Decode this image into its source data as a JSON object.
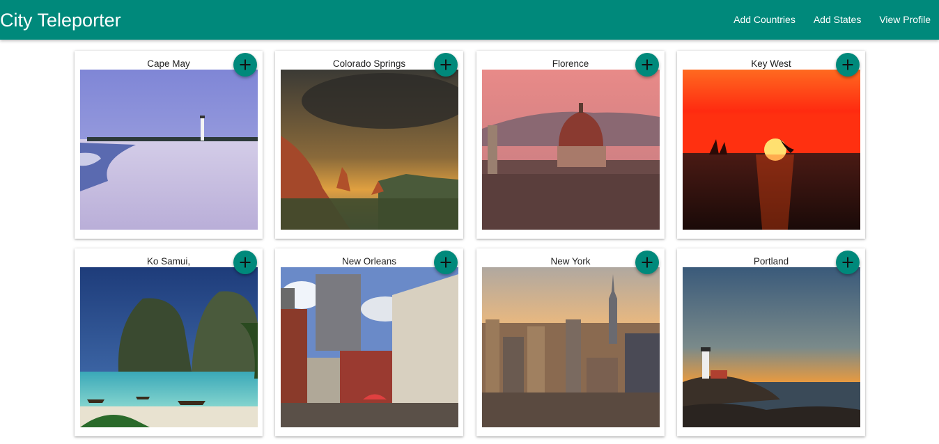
{
  "app": {
    "title": "City Teleporter",
    "accent_color": "#00897b"
  },
  "nav": {
    "items": [
      {
        "label": "Add Countries"
      },
      {
        "label": "Add States"
      },
      {
        "label": "View Profile"
      }
    ]
  },
  "cities": [
    {
      "name": "Cape May",
      "add_icon": "plus-icon"
    },
    {
      "name": "Colorado Springs",
      "add_icon": "plus-icon"
    },
    {
      "name": "Florence",
      "add_icon": "plus-icon"
    },
    {
      "name": "Key West",
      "add_icon": "plus-icon"
    },
    {
      "name": "Ko Samui,",
      "add_icon": "plus-icon"
    },
    {
      "name": "New Orleans",
      "add_icon": "plus-icon"
    },
    {
      "name": "New York",
      "add_icon": "plus-icon"
    },
    {
      "name": "Portland",
      "add_icon": "plus-icon"
    }
  ]
}
